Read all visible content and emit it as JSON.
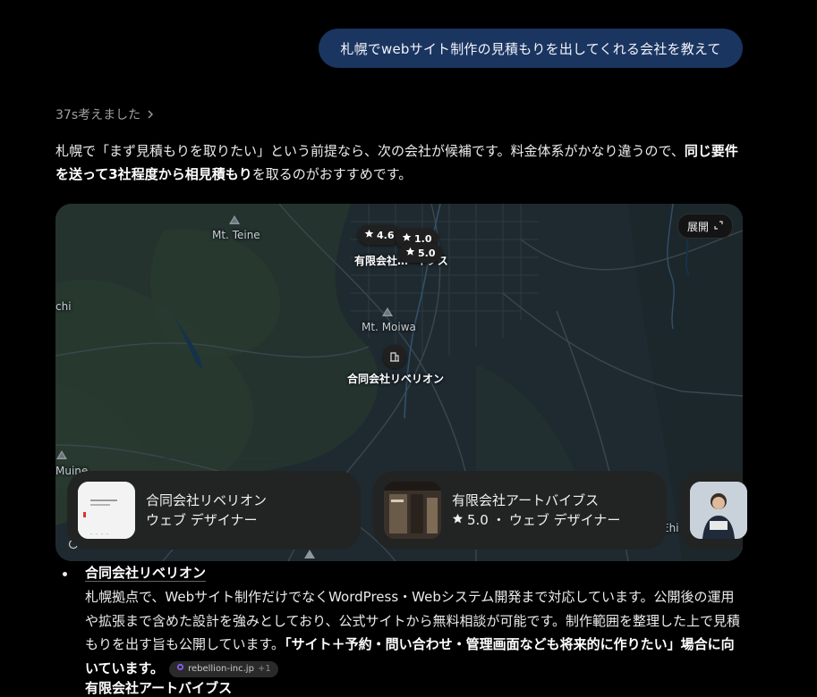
{
  "user_message": "札幌でwebサイト制作の見積もりを出してくれる会社を教えて",
  "thinking": {
    "label": "37s考えました"
  },
  "intro": {
    "part1": "札幌で「まず見積もりを取りたい」という前提なら、次の会社が候補です。料金体系がかなり違うので、",
    "bold": "同じ要件を送って3社程度から相見積もり",
    "part2": "を取るのがおすすめです。"
  },
  "map": {
    "expand_label": "展開",
    "places": {
      "teine": "Mt. Teine",
      "moiwa": "Mt. Moiwa",
      "chi": "chi",
      "muine": "Muine",
      "ehi": "Ehi"
    },
    "pins": [
      {
        "rating": "4.6"
      },
      {
        "rating": "1.0"
      },
      {
        "rating": "5.0"
      }
    ],
    "labels": {
      "artvibes": "有限会社… ·イブス",
      "rebellion": "合同会社リベリオン"
    }
  },
  "cards": [
    {
      "name": "合同会社リベリオン",
      "category": "ウェブ デザイナー"
    },
    {
      "name": "有限会社アートバイブス",
      "rating": "5.0",
      "category": "ウェブ デザイナー",
      "separator": "・"
    }
  ],
  "result": {
    "title": "合同会社リベリオン",
    "body": "札幌拠点で、Webサイト制作だけでなくWordPress・Webシステム開発まで対応しています。公開後の運用や拡張まで含めた設計を強みとしており、公式サイトから無料相談が可能です。制作範囲を整理した上で見積もりを出す旨も公開しています。",
    "body_bold": "「サイト＋予約・問い合わせ・管理画面なども将来的に作りたい」場合に向いています。",
    "source_domain": "rebellion-inc.jp",
    "source_extra": "+1",
    "next_title_partial": "有限会社アートバイブス"
  },
  "colors": {
    "bubble": "#1a3560",
    "map_bg": "#1f2a30",
    "card_bg": "#222323"
  }
}
